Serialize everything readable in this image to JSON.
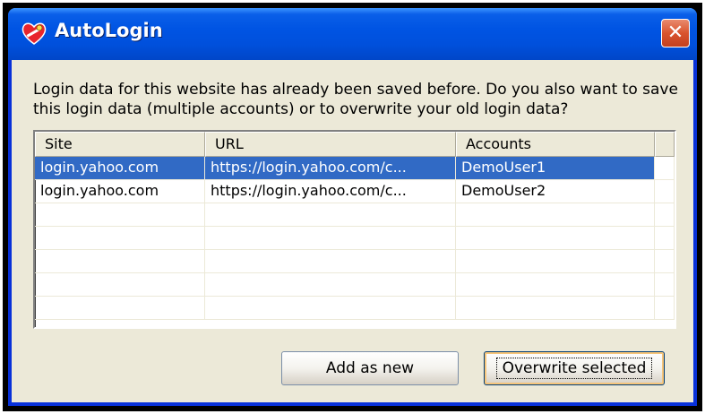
{
  "window": {
    "title": "AutoLogin",
    "close_label": "✕"
  },
  "message": "Login data for this website has already been saved before. Do you also want to save this login data (multiple accounts) or to overwrite your old login data?",
  "table": {
    "columns": [
      "Site",
      "URL",
      "Accounts"
    ],
    "rows": [
      {
        "site": "login.yahoo.com",
        "url": "https://login.yahoo.com/c...",
        "account": "DemoUser1",
        "selected": true
      },
      {
        "site": "login.yahoo.com",
        "url": "https://login.yahoo.com/c...",
        "account": "DemoUser2",
        "selected": false
      }
    ]
  },
  "buttons": {
    "add_new": "Add as new",
    "overwrite": "Overwrite selected"
  },
  "colors": {
    "titlebar": "#0054e3",
    "selection": "#316ac5",
    "close": "#d9542f"
  },
  "icons": {
    "title": "heart-key-icon"
  }
}
